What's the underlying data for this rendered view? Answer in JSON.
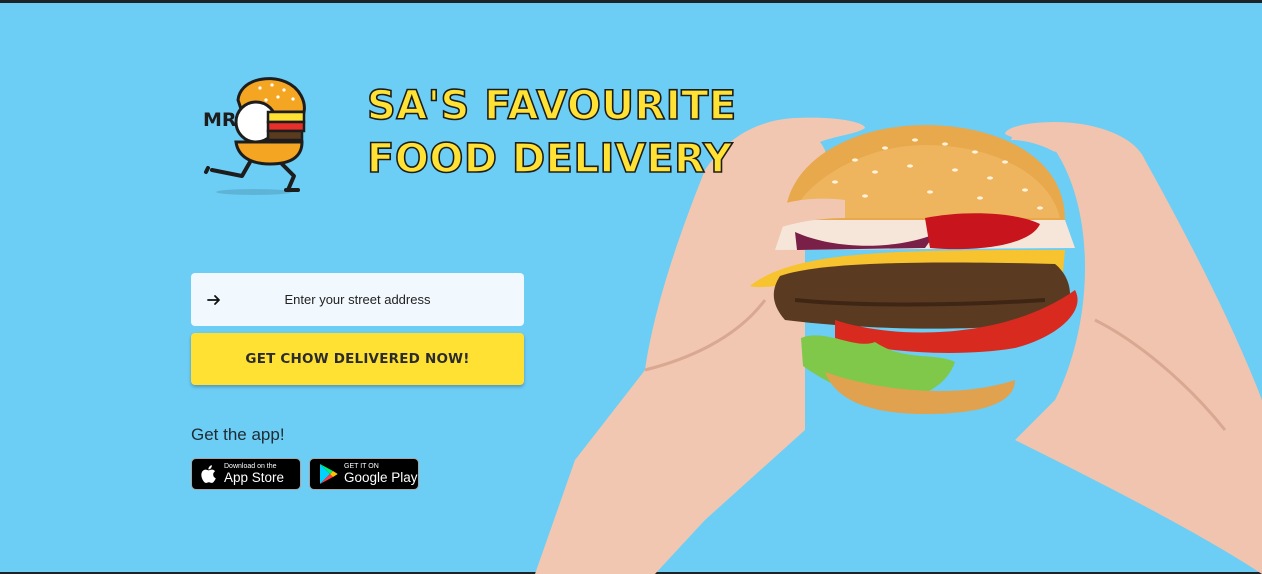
{
  "header": {
    "headline_line1": "SA'S FAVOURITE",
    "headline_line2": "FOOD DELIVERY"
  },
  "logo": {
    "text": "MR"
  },
  "search": {
    "placeholder": "Enter your street address",
    "value": ""
  },
  "cta": {
    "label": "GET CHOW DELIVERED NOW!"
  },
  "app": {
    "heading": "Get the app!",
    "appstore_small": "Download on the",
    "appstore_big": "App Store",
    "googleplay_small": "GET IT ON",
    "googleplay_big": "Google Play"
  },
  "colors": {
    "background": "#6ccdf5",
    "accent_yellow": "#ffe134",
    "text_dark": "#1d1d1d"
  },
  "icons": [
    "arrow-right-icon",
    "apple-icon",
    "google-play-icon"
  ]
}
